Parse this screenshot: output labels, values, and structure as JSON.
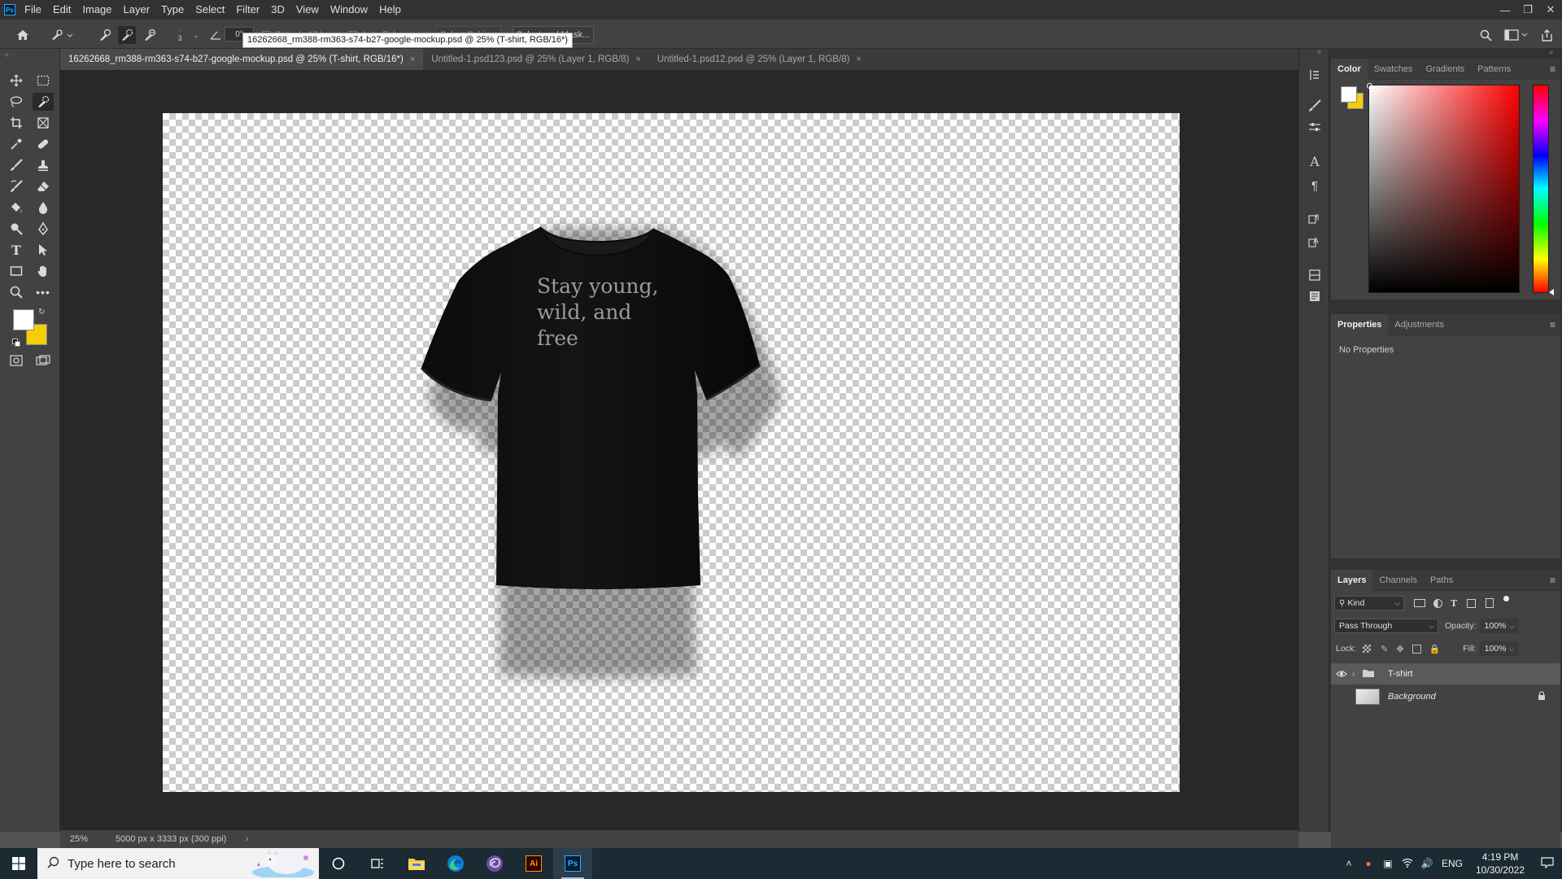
{
  "app": {
    "logo_text": "Ps"
  },
  "menu": [
    "File",
    "Edit",
    "Image",
    "Layer",
    "Type",
    "Select",
    "Filter",
    "3D",
    "View",
    "Window",
    "Help"
  ],
  "options_bar": {
    "brush_size": "3",
    "angle": "0°",
    "sample_all_layers_label": "Sample All Layers",
    "auto_enhance_label": "Auto-Enhance",
    "select_subject_label": "Select Subject",
    "select_and_mask_label": "Select and Mask..."
  },
  "tooltip": "16262668_rm388-rm363-s74-b27-google-mockup.psd @ 25% (T-shirt, RGB/16*)",
  "tabs": [
    {
      "label": "16262668_rm388-rm363-s74-b27-google-mockup.psd @ 25% (T-shirt, RGB/16*)",
      "active": true
    },
    {
      "label": "Untitled-1.psd123.psd @ 25% (Layer 1, RGB/8)",
      "active": false
    },
    {
      "label": "Untitled-1.psd12.psd @ 25% (Layer 1, RGB/8)",
      "active": false
    }
  ],
  "tab_close_glyph": "×",
  "canvas": {
    "shirt_text": "Stay young,\nwild, and\nfree"
  },
  "status": {
    "zoom": "25%",
    "doc_size": "5000 px x 3333 px (300 ppi)",
    "arrow": "›"
  },
  "color_panel": {
    "tabs": [
      "Color",
      "Swatches",
      "Gradients",
      "Patterns"
    ]
  },
  "properties_panel": {
    "tabs": [
      "Properties",
      "Adjustments"
    ],
    "message": "No Properties"
  },
  "layers_panel": {
    "tabs": [
      "Layers",
      "Channels",
      "Paths"
    ],
    "filter_kind": "Kind",
    "blend_mode": "Pass Through",
    "opacity_label": "Opacity:",
    "opacity_value": "100%",
    "lock_label": "Lock:",
    "fill_label": "Fill:",
    "fill_value": "100%",
    "layers": [
      {
        "name": "T-shirt",
        "type": "group",
        "visible": true,
        "selected": true
      },
      {
        "name": "Background",
        "type": "pixel",
        "visible": false,
        "selected": false,
        "locked": true
      }
    ]
  },
  "taskbar": {
    "search_placeholder": "Type here to search",
    "language": "ENG",
    "time": "4:19 PM",
    "date": "10/30/2022",
    "apps": [
      "cortana-icon",
      "task-view-icon",
      "file-explorer-icon",
      "edge-icon",
      "app-swirl-icon",
      "illustrator-icon",
      "photoshop-icon"
    ],
    "illustrator_label": "Ai",
    "photoshop_label": "Ps"
  },
  "colors": {
    "foreground": "#ffffff",
    "background": "#f5d000",
    "accent": "#31a8ff"
  }
}
